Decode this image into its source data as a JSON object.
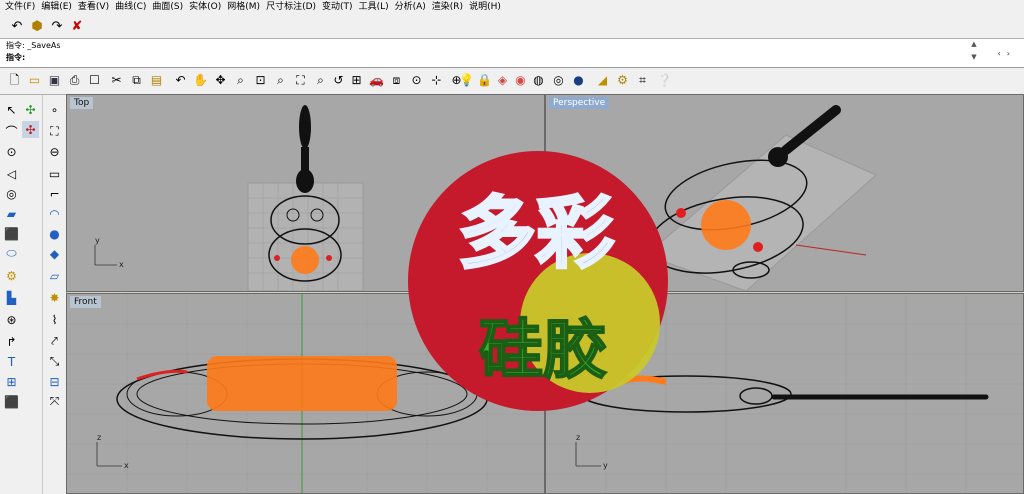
{
  "menu": [
    "文件(F)",
    "编辑(E)",
    "查看(V)",
    "曲线(C)",
    "曲面(S)",
    "实体(O)",
    "网格(M)",
    "尺寸标注(D)",
    "变动(T)",
    "工具(L)",
    "分析(A)",
    "渲染(R)",
    "说明(H)"
  ],
  "command": {
    "history_label": "指令:",
    "history_value": "_SaveAs",
    "prompt_label": "指令:"
  },
  "viewports": {
    "top": "Top",
    "perspective": "Perspective",
    "front": "Front",
    "right": ""
  },
  "axes": {
    "x": "x",
    "y": "y",
    "z": "z"
  },
  "logo": {
    "line1": "多彩",
    "line2": "硅胶"
  },
  "colors": {
    "viewport_bg": "#a7a7a7",
    "logo_red": "#c41a2c",
    "logo_yellow": "#c8c82a",
    "orange": "#ff7a1a"
  }
}
